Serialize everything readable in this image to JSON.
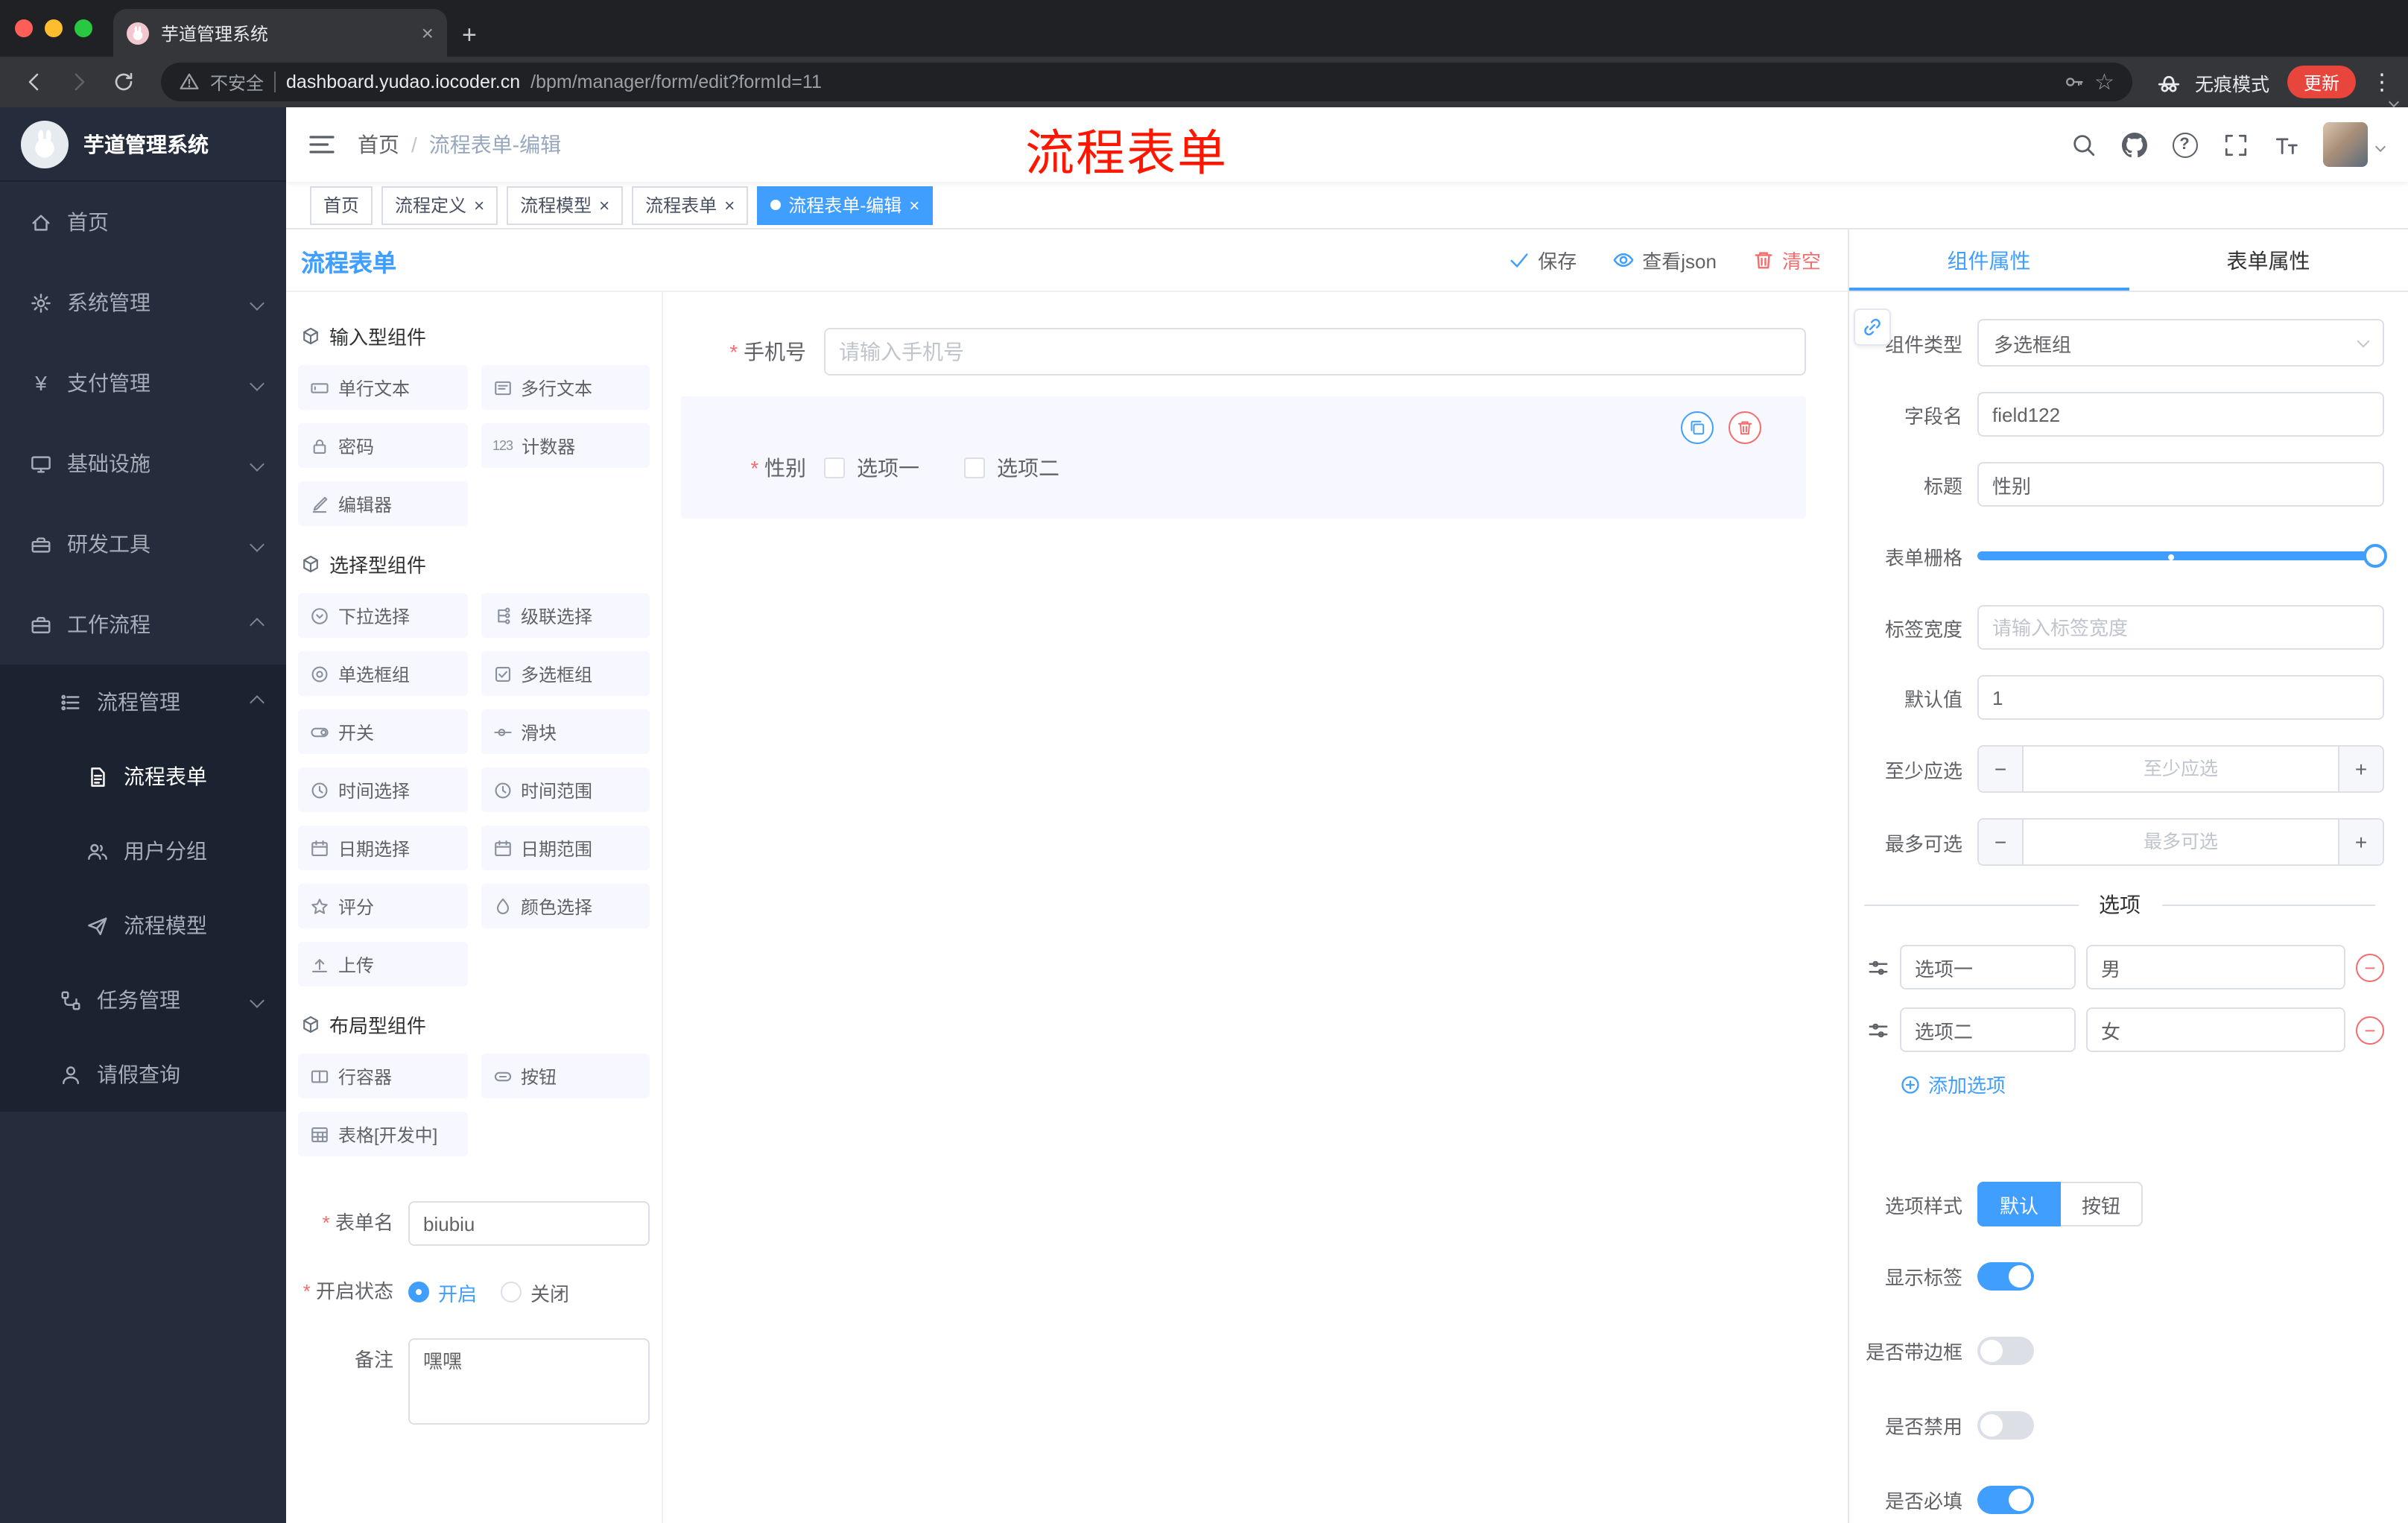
{
  "colors": {
    "primary": "#409EFF",
    "danger": "#F56C6C",
    "annotation": "#FE1600",
    "update_pill": "#E8453C",
    "sidebar_bg": "#252D3C"
  },
  "icons": {
    "minus": "−",
    "plus": "+",
    "close": "×",
    "kebab": "⋮",
    "question": "?",
    "star": "☆",
    "yen": "¥",
    "counter": "123"
  },
  "browser": {
    "tab_title": "芋道管理系统",
    "security": "不安全",
    "host": "dashboard.yudao.iocoder.cn",
    "path": "/bpm/manager/form/edit?formId=11",
    "incognito": "无痕模式",
    "update": "更新"
  },
  "sidebar": {
    "logo_title": "芋道管理系统",
    "menu": [
      {
        "label": "首页"
      },
      {
        "label": "系统管理"
      },
      {
        "label": "支付管理"
      },
      {
        "label": "基础设施"
      },
      {
        "label": "研发工具"
      },
      {
        "label": "工作流程"
      }
    ],
    "submenu": [
      {
        "label": "流程管理"
      },
      {
        "label": "流程表单"
      },
      {
        "label": "用户分组"
      },
      {
        "label": "流程模型"
      },
      {
        "label": "任务管理"
      },
      {
        "label": "请假查询"
      }
    ]
  },
  "navbar": {
    "breadcrumb_home": "首页",
    "breadcrumb_separator": "/",
    "breadcrumb_current": "流程表单-编辑",
    "annotation": "流程表单"
  },
  "tags": [
    {
      "label": "首页"
    },
    {
      "label": "流程定义"
    },
    {
      "label": "流程模型"
    },
    {
      "label": "流程表单"
    },
    {
      "label": "流程表单-编辑"
    }
  ],
  "designer": {
    "title": "流程表单",
    "save": "保存",
    "view_json": "查看json",
    "clear": "清空"
  },
  "palette": {
    "sections": [
      {
        "title": "输入型组件",
        "items": [
          "单行文本",
          "多行文本",
          "密码",
          "计数器",
          "编辑器"
        ]
      },
      {
        "title": "选择型组件",
        "items": [
          "下拉选择",
          "级联选择",
          "单选框组",
          "多选框组",
          "开关",
          "滑块",
          "时间选择",
          "时间范围",
          "日期选择",
          "日期范围",
          "评分",
          "颜色选择",
          "上传"
        ]
      },
      {
        "title": "布局型组件",
        "items": [
          "行容器",
          "按钮",
          "表格[开发中]"
        ]
      }
    ],
    "form": {
      "name_label": "表单名",
      "name_value": "biubiu",
      "status_label": "开启状态",
      "status_on": "开启",
      "status_off": "关闭",
      "remark_label": "备注",
      "remark_value": "嘿嘿"
    }
  },
  "canvas": {
    "phone_label": "手机号",
    "phone_placeholder": "请输入手机号",
    "gender_label": "性别",
    "gender_option1": "选项一",
    "gender_option2": "选项二"
  },
  "panel": {
    "tab_component": "组件属性",
    "tab_form": "表单属性",
    "component_type_label": "组件类型",
    "component_type_value": "多选框组",
    "field_name_label": "字段名",
    "field_name_value": "field122",
    "title_label": "标题",
    "title_value": "性别",
    "grid_label": "表单栅格",
    "label_width_label": "标签宽度",
    "label_width_placeholder": "请输入标签宽度",
    "default_label": "默认值",
    "default_value": "1",
    "min_label": "至少应选",
    "min_placeholder": "至少应选",
    "max_label": "最多可选",
    "max_placeholder": "最多可选",
    "options_divider": "选项",
    "options": [
      {
        "label": "选项一",
        "value": "男"
      },
      {
        "label": "选项二",
        "value": "女"
      }
    ],
    "add_option": "添加选项",
    "style_label": "选项样式",
    "style_default": "默认",
    "style_button": "按钮",
    "switch_show_label": "显示标签",
    "switch_border": "是否带边框",
    "switch_disabled": "是否禁用",
    "switch_required": "是否必填"
  }
}
